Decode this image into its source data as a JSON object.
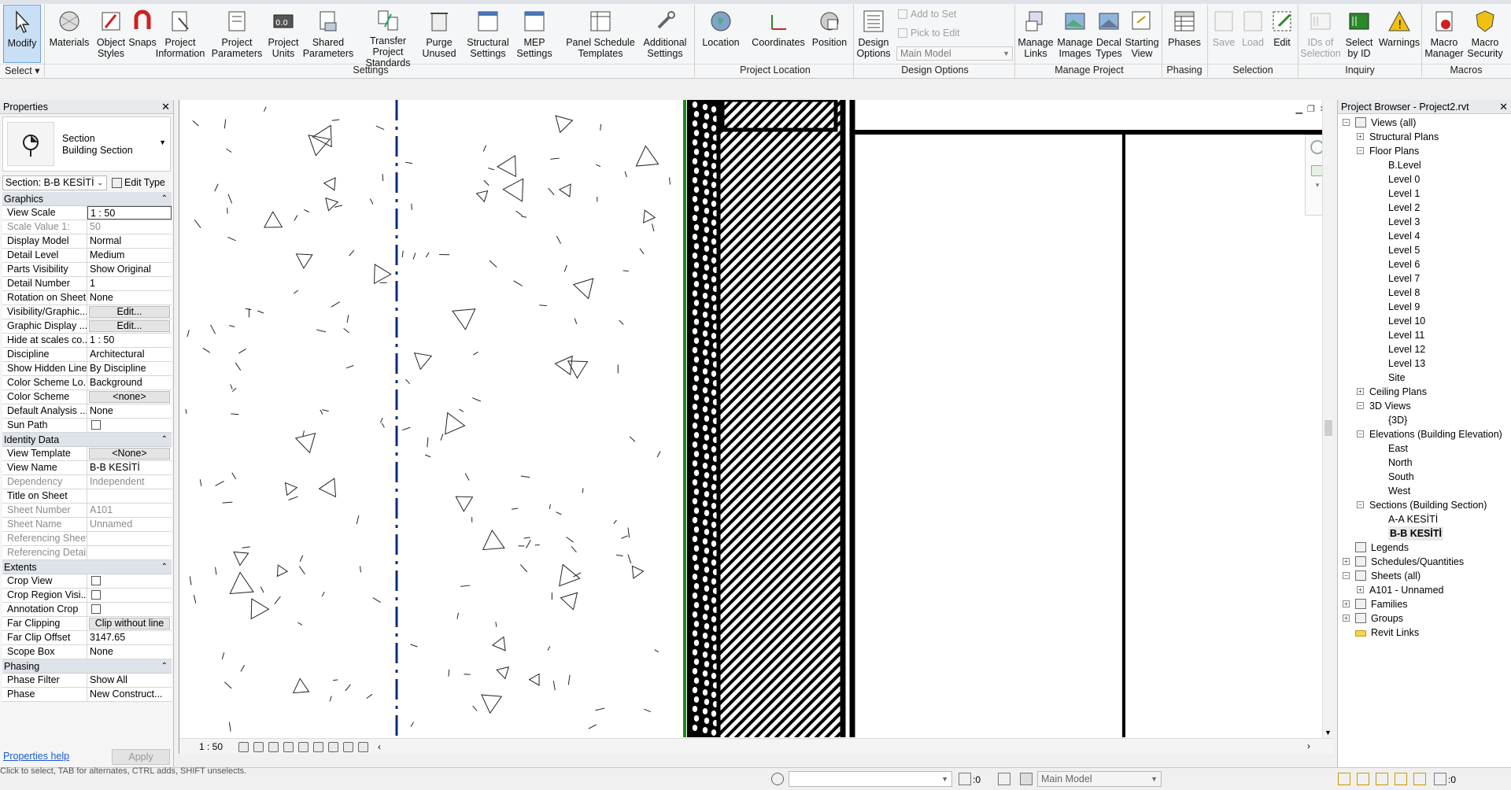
{
  "ribbon": {
    "select_panel": {
      "modify": "Modify",
      "label": "Select"
    },
    "settings_buttons": [
      {
        "label": "Materials",
        "icon": "materials-icon"
      },
      {
        "label": "Object\nStyles",
        "icon": "object-styles-icon"
      },
      {
        "label": "Snaps",
        "icon": "snaps-icon"
      },
      {
        "label": "Project\nInformation",
        "icon": "project-information-icon"
      },
      {
        "label": "Project\nParameters",
        "icon": "project-parameters-icon"
      },
      {
        "label": "Project\nUnits",
        "icon": "project-units-icon"
      },
      {
        "label": "Shared\nParameters",
        "icon": "shared-parameters-icon"
      },
      {
        "label": "Transfer\nProject Standards",
        "icon": "transfer-standards-icon"
      },
      {
        "label": "Purge\nUnused",
        "icon": "purge-unused-icon"
      },
      {
        "label": "Structural\nSettings",
        "icon": "structural-settings-icon"
      },
      {
        "label": "MEP\nSettings",
        "icon": "mep-settings-icon"
      },
      {
        "label": "Panel Schedule\nTemplates",
        "icon": "panel-schedule-icon"
      },
      {
        "label": "Additional\nSettings",
        "icon": "additional-settings-icon"
      }
    ],
    "settings_label": "Settings",
    "location_buttons": [
      {
        "label": "Location",
        "icon": "location-icon"
      },
      {
        "label": "Coordinates",
        "icon": "coordinates-icon"
      },
      {
        "label": "Position",
        "icon": "position-icon"
      }
    ],
    "location_label": "Project Location",
    "design_options": {
      "button": "Design\nOptions",
      "add_to_set": "Add to Set",
      "pick_to_edit": "Pick to Edit",
      "main_model": "Main Model",
      "label": "Design Options"
    },
    "manage_buttons": [
      {
        "label": "Manage\nLinks",
        "icon": "manage-links-icon"
      },
      {
        "label": "Manage\nImages",
        "icon": "manage-images-icon"
      },
      {
        "label": "Decal\nTypes",
        "icon": "decal-types-icon"
      },
      {
        "label": "Starting\nView",
        "icon": "starting-view-icon"
      }
    ],
    "manage_label": "Manage Project",
    "phasing": {
      "button": "Phases",
      "label": "Phasing"
    },
    "selection_buttons": [
      {
        "label": "Save",
        "icon": "save-selection-icon",
        "disabled": true
      },
      {
        "label": "Load",
        "icon": "load-selection-icon",
        "disabled": true
      },
      {
        "label": "Edit",
        "icon": "edit-selection-icon",
        "disabled": false
      }
    ],
    "selection_label": "Selection",
    "inquiry_buttons": [
      {
        "label": "IDs of\nSelection",
        "icon": "ids-of-selection-icon",
        "disabled": true
      },
      {
        "label": "Select\nby ID",
        "icon": "select-by-id-icon",
        "disabled": false
      },
      {
        "label": "Warnings",
        "icon": "warnings-icon",
        "disabled": false
      }
    ],
    "inquiry_label": "Inquiry",
    "macros_buttons": [
      {
        "label": "Macro\nManager",
        "icon": "macro-manager-icon"
      },
      {
        "label": "Macro\nSecurity",
        "icon": "macro-security-icon"
      }
    ],
    "macros_label": "Macros"
  },
  "properties": {
    "title": "Properties",
    "type_name": "Section",
    "type_sub": "Building Section",
    "instance": "Section: B-B KESİTİ",
    "edit_type": "Edit Type",
    "groups": [
      {
        "name": "Graphics",
        "rows": [
          {
            "n": "View Scale",
            "v": "1 : 50",
            "kind": "field"
          },
          {
            "n": "Scale Value    1:",
            "v": "50",
            "kind": "ro"
          },
          {
            "n": "Display Model",
            "v": "Normal"
          },
          {
            "n": "Detail Level",
            "v": "Medium"
          },
          {
            "n": "Parts Visibility",
            "v": "Show Original"
          },
          {
            "n": "Detail Number",
            "v": "1"
          },
          {
            "n": "Rotation on Sheet",
            "v": "None"
          },
          {
            "n": "Visibility/Graphic...",
            "v": "Edit...",
            "kind": "btn"
          },
          {
            "n": "Graphic Display ...",
            "v": "Edit...",
            "kind": "btn"
          },
          {
            "n": "Hide at scales co...",
            "v": "1 : 50"
          },
          {
            "n": "Discipline",
            "v": "Architectural"
          },
          {
            "n": "Show Hidden Lines",
            "v": "By Discipline"
          },
          {
            "n": "Color Scheme Lo...",
            "v": "Background"
          },
          {
            "n": "Color Scheme",
            "v": "<none>",
            "kind": "btn"
          },
          {
            "n": "Default Analysis ...",
            "v": "None"
          },
          {
            "n": "Sun Path",
            "v": "",
            "kind": "chk"
          }
        ]
      },
      {
        "name": "Identity Data",
        "rows": [
          {
            "n": "View Template",
            "v": "<None>",
            "kind": "btn"
          },
          {
            "n": "View Name",
            "v": "B-B KESİTİ"
          },
          {
            "n": "Dependency",
            "v": "Independent",
            "kind": "ro"
          },
          {
            "n": "Title on Sheet",
            "v": ""
          },
          {
            "n": "Sheet Number",
            "v": "A101",
            "kind": "ro"
          },
          {
            "n": "Sheet Name",
            "v": "Unnamed",
            "kind": "ro"
          },
          {
            "n": "Referencing Sheet",
            "v": "",
            "kind": "ro"
          },
          {
            "n": "Referencing Detail",
            "v": "",
            "kind": "ro"
          }
        ]
      },
      {
        "name": "Extents",
        "rows": [
          {
            "n": "Crop View",
            "v": "",
            "kind": "chk"
          },
          {
            "n": "Crop Region Visi...",
            "v": "",
            "kind": "chk"
          },
          {
            "n": "Annotation Crop",
            "v": "",
            "kind": "chk"
          },
          {
            "n": "Far Clipping",
            "v": "Clip without line",
            "kind": "btn"
          },
          {
            "n": "Far Clip Offset",
            "v": "3147.65"
          },
          {
            "n": "Scope Box",
            "v": "None"
          }
        ]
      },
      {
        "name": "Phasing",
        "rows": [
          {
            "n": "Phase Filter",
            "v": "Show All"
          },
          {
            "n": "Phase",
            "v": "New Construct..."
          }
        ]
      }
    ],
    "help": "Properties help",
    "apply": "Apply"
  },
  "view": {
    "scale": "1 : 50"
  },
  "browser": {
    "title": "Project Browser - Project2.rvt",
    "nodes": [
      {
        "label": "Views (all)",
        "level": 0,
        "exp": "-",
        "icon": true
      },
      {
        "label": "Structural Plans",
        "level": 1,
        "exp": "+"
      },
      {
        "label": "Floor Plans",
        "level": 1,
        "exp": "-"
      },
      {
        "label": "B.Level",
        "level": 2
      },
      {
        "label": "Level 0",
        "level": 2
      },
      {
        "label": "Level 1",
        "level": 2
      },
      {
        "label": "Level 2",
        "level": 2
      },
      {
        "label": "Level 3",
        "level": 2
      },
      {
        "label": "Level 4",
        "level": 2
      },
      {
        "label": "Level 5",
        "level": 2
      },
      {
        "label": "Level 6",
        "level": 2
      },
      {
        "label": "Level 7",
        "level": 2
      },
      {
        "label": "Level 8",
        "level": 2
      },
      {
        "label": "Level 9",
        "level": 2
      },
      {
        "label": "Level 10",
        "level": 2
      },
      {
        "label": "Level 11",
        "level": 2
      },
      {
        "label": "Level 12",
        "level": 2
      },
      {
        "label": "Level 13",
        "level": 2
      },
      {
        "label": "Site",
        "level": 2
      },
      {
        "label": "Ceiling Plans",
        "level": 1,
        "exp": "+"
      },
      {
        "label": "3D Views",
        "level": 1,
        "exp": "-"
      },
      {
        "label": "{3D}",
        "level": 2
      },
      {
        "label": "Elevations (Building Elevation)",
        "level": 1,
        "exp": "-"
      },
      {
        "label": "East",
        "level": 2
      },
      {
        "label": "North",
        "level": 2
      },
      {
        "label": "South",
        "level": 2
      },
      {
        "label": "West",
        "level": 2
      },
      {
        "label": "Sections (Building Section)",
        "level": 1,
        "exp": "-"
      },
      {
        "label": "A-A KESİTİ",
        "level": 2
      },
      {
        "label": "B-B KESİTİ",
        "level": 2,
        "selected": true
      },
      {
        "label": "Legends",
        "level": 0,
        "icon": true
      },
      {
        "label": "Schedules/Quantities",
        "level": 0,
        "exp": "+",
        "icon": true
      },
      {
        "label": "Sheets (all)",
        "level": 0,
        "exp": "-",
        "icon": true
      },
      {
        "label": "A101 - Unnamed",
        "level": 1,
        "exp": "+"
      },
      {
        "label": "Families",
        "level": 0,
        "exp": "+",
        "icon": true
      },
      {
        "label": "Groups",
        "level": 0,
        "exp": "+",
        "icon": true
      },
      {
        "label": "Revit Links",
        "level": 0,
        "icon": true,
        "link": true
      }
    ]
  },
  "statusbar": {
    "left_text": "Click to select, TAB for alternates, CTRL adds, SHIFT unselects.",
    "workset_value": "",
    "selection_count": ":0",
    "design_option": "Main Model",
    "filter_count": ":0"
  },
  "colors": {
    "accent": "#1f6fc5",
    "ribbon_bg": "#f5f6f7",
    "dashed_line": "#0b2e7a",
    "green_line": "#1b8a1b"
  }
}
